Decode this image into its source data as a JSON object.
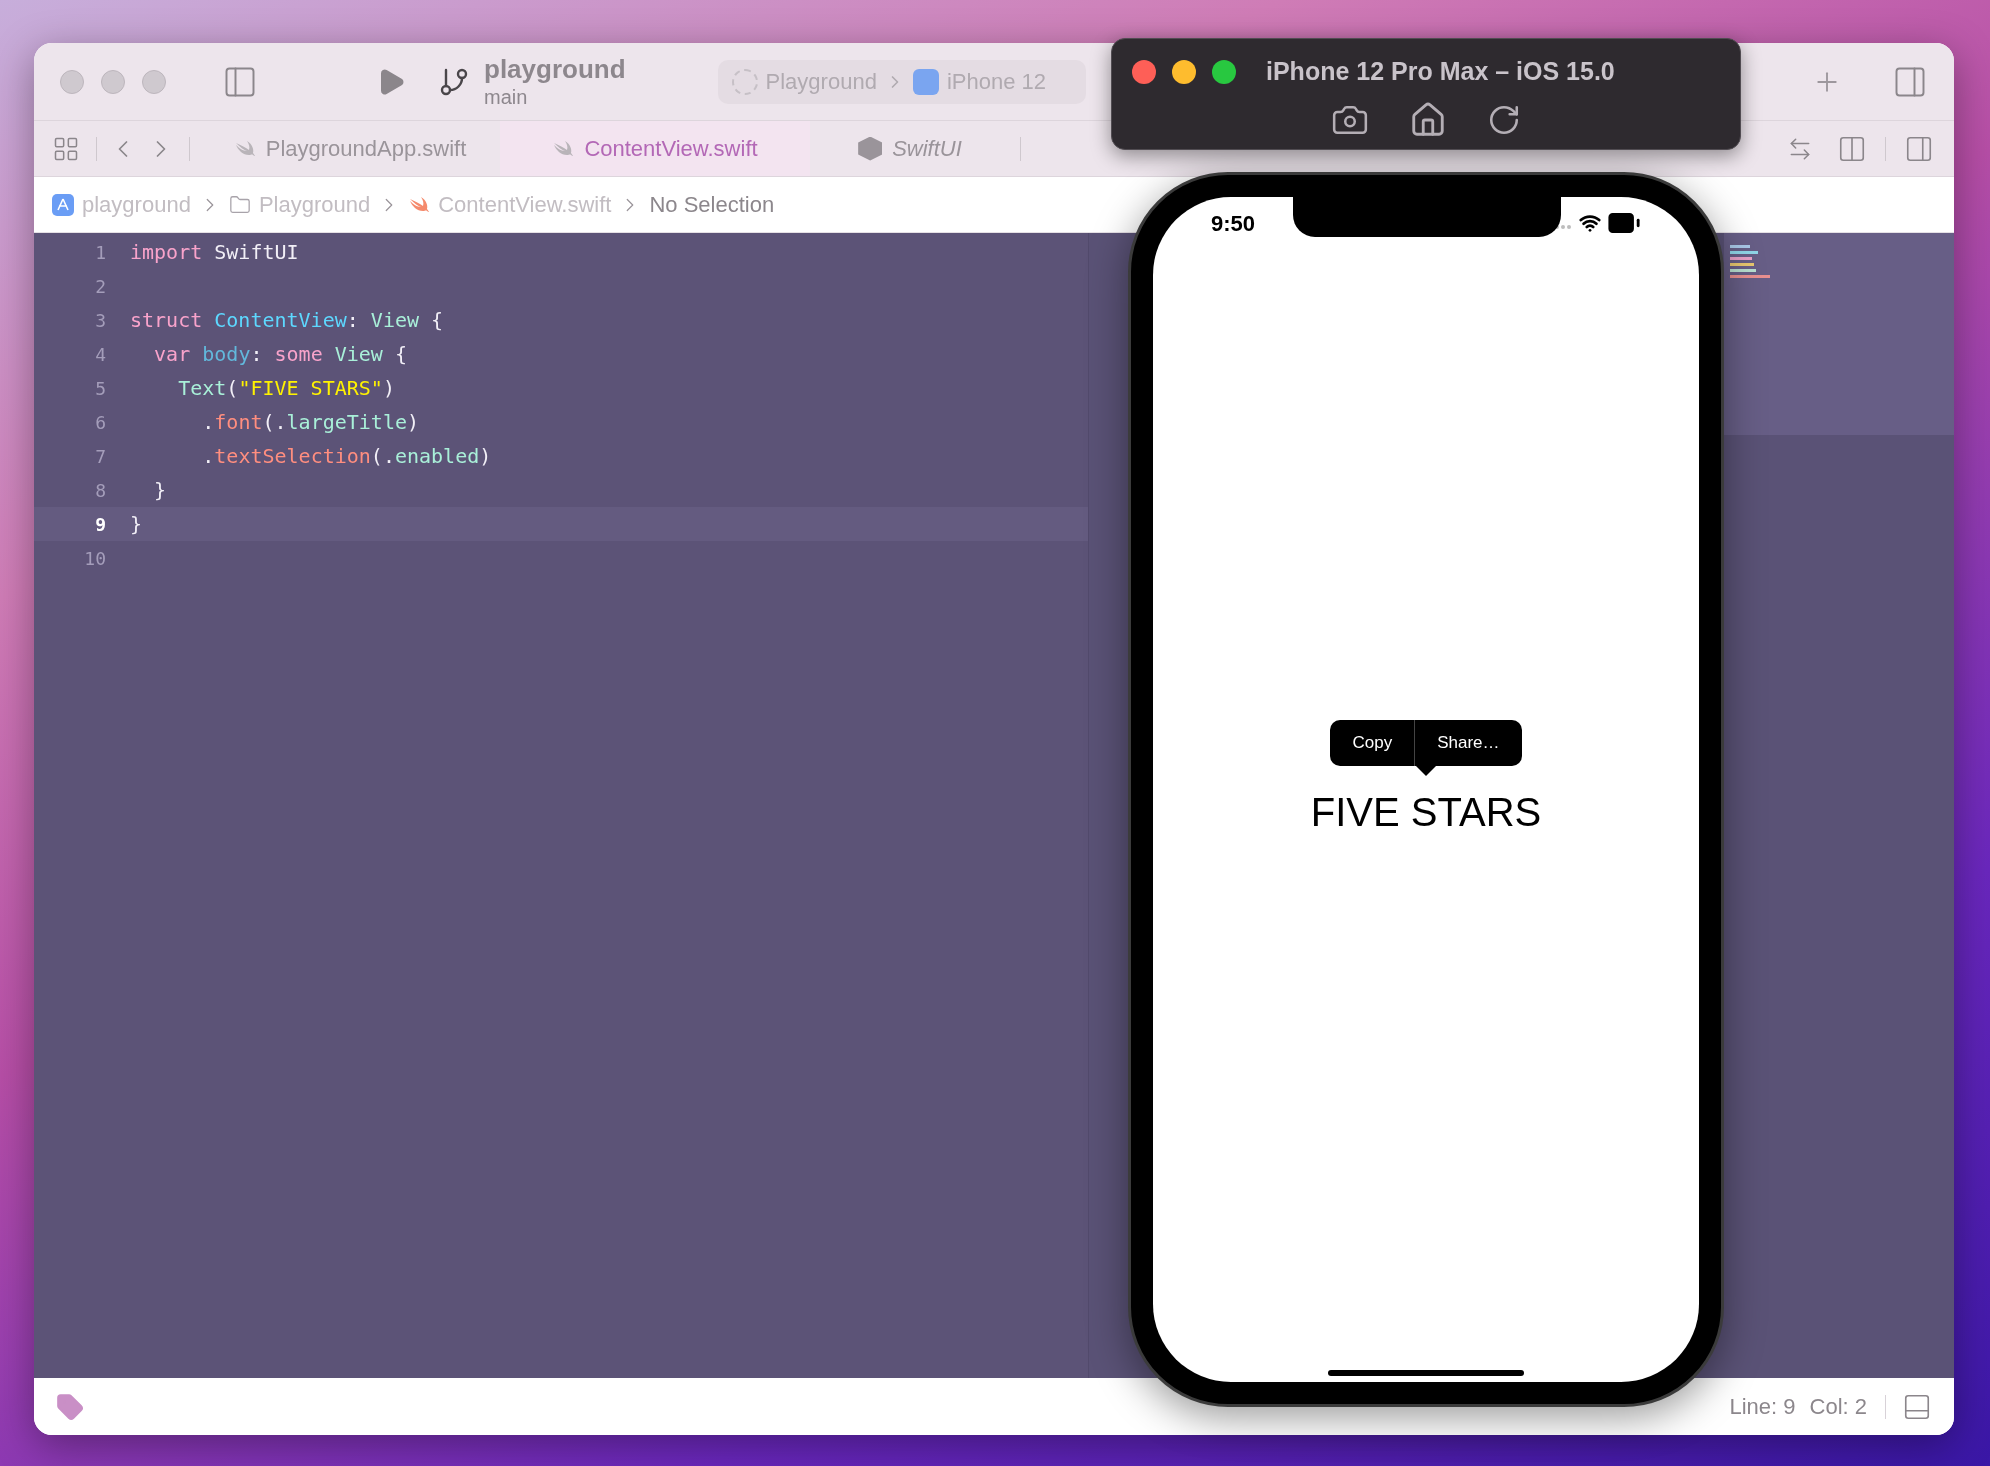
{
  "xcode": {
    "toolbar": {
      "project": "playground",
      "branch": "main",
      "scheme": "Playground",
      "destination": "iPhone 12"
    },
    "tabs": [
      {
        "label": "PlaygroundApp.swift",
        "kind": "swift",
        "selected": false
      },
      {
        "label": "ContentView.swift",
        "kind": "swift",
        "selected": true
      },
      {
        "label": "SwiftUI",
        "kind": "module",
        "selected": false
      }
    ],
    "breadcrumb": [
      {
        "label": "playground",
        "kind": "app"
      },
      {
        "label": "Playground",
        "kind": "folder"
      },
      {
        "label": "ContentView.swift",
        "kind": "swift"
      },
      {
        "label": "No Selection",
        "kind": "none"
      }
    ],
    "editor": {
      "lines": [
        {
          "number": "1",
          "current": false,
          "tokens": [
            {
              "text": "import",
              "kind": "keyword"
            },
            {
              "text": " SwiftUI",
              "kind": "plain"
            }
          ]
        },
        {
          "number": "2",
          "current": false
        },
        {
          "number": "3",
          "current": false,
          "tokens": [
            {
              "text": "struct",
              "kind": "keyword"
            },
            {
              "text": " ContentView",
              "kind": "decl"
            },
            {
              "text": ": ",
              "kind": "plain"
            },
            {
              "text": "View",
              "kind": "type"
            },
            {
              "text": " {",
              "kind": "plain"
            }
          ]
        },
        {
          "number": "4",
          "current": false,
          "tokens": [
            {
              "text": "  var",
              "kind": "keyword"
            },
            {
              "text": " body",
              "kind": "prop"
            },
            {
              "text": ": ",
              "kind": "plain"
            },
            {
              "text": "some",
              "kind": "keyword"
            },
            {
              "text": " View",
              "kind": "type"
            },
            {
              "text": " {",
              "kind": "plain"
            }
          ]
        },
        {
          "number": "5",
          "current": false,
          "tokens": [
            {
              "text": "    Text",
              "kind": "type"
            },
            {
              "text": "(",
              "kind": "plain"
            },
            {
              "text": "\"FIVE STARS\"",
              "kind": "string"
            },
            {
              "text": ")",
              "kind": "plain"
            }
          ]
        },
        {
          "number": "6",
          "current": false,
          "tokens": [
            {
              "text": "      .",
              "kind": "plain"
            },
            {
              "text": "font",
              "kind": "method"
            },
            {
              "text": "(.",
              "kind": "plain"
            },
            {
              "text": "largeTitle",
              "kind": "type"
            },
            {
              "text": ")",
              "kind": "plain"
            }
          ]
        },
        {
          "number": "7",
          "current": false,
          "tokens": [
            {
              "text": "      .",
              "kind": "plain"
            },
            {
              "text": "textSelection",
              "kind": "method"
            },
            {
              "text": "(.",
              "kind": "plain"
            },
            {
              "text": "enabled",
              "kind": "type"
            },
            {
              "text": ")",
              "kind": "plain"
            }
          ]
        },
        {
          "number": "8",
          "current": false,
          "tokens": [
            {
              "text": "  }",
              "kind": "plain"
            }
          ]
        },
        {
          "number": "9",
          "current": true,
          "tokens": [
            {
              "text": "}",
              "kind": "plain"
            }
          ]
        },
        {
          "number": "10",
          "current": false
        }
      ]
    },
    "status_bar": {
      "line": "Line: 9",
      "col": "Col: 2"
    }
  },
  "simulator": {
    "title": "iPhone 12 Pro Max – iOS 15.0",
    "screen": {
      "time": "9:50",
      "menu": [
        "Copy",
        "Share…"
      ],
      "text": "FIVE STARS"
    }
  }
}
